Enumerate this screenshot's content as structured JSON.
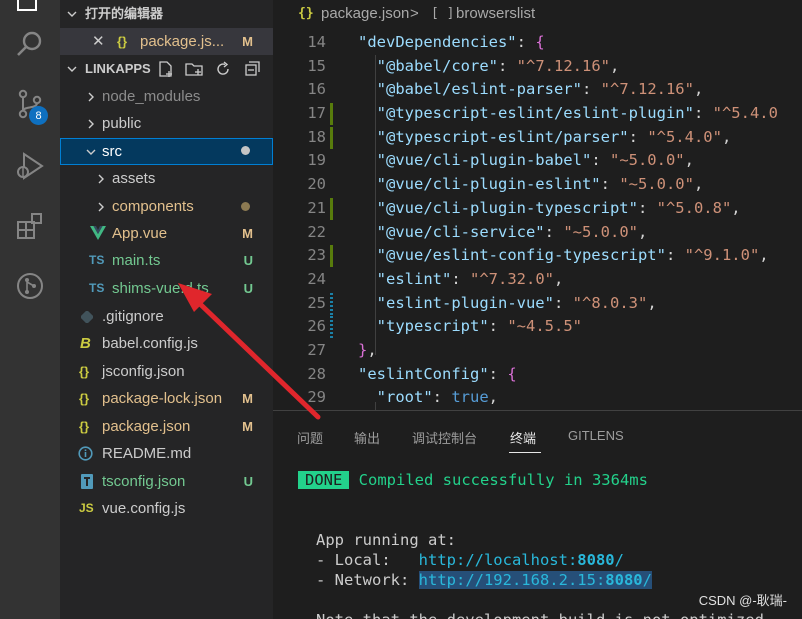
{
  "sidebar": {
    "open_editors_title": "打开的编辑器",
    "open_editor": {
      "name": "package.js...",
      "status": "M"
    },
    "project_title": "LINKAPPS",
    "items": [
      {
        "name": "node_modules",
        "status": ""
      },
      {
        "name": "public",
        "status": ""
      },
      {
        "name": "src",
        "status": ""
      },
      {
        "name": "assets",
        "status": ""
      },
      {
        "name": "components",
        "status": ""
      },
      {
        "name": "App.vue",
        "status": "M"
      },
      {
        "name": "main.ts",
        "status": "U"
      },
      {
        "name": "shims-vue.d.ts",
        "status": "U"
      },
      {
        "name": ".gitignore",
        "status": ""
      },
      {
        "name": "babel.config.js",
        "status": ""
      },
      {
        "name": "jsconfig.json",
        "status": ""
      },
      {
        "name": "package-lock.json",
        "status": "M"
      },
      {
        "name": "package.json",
        "status": "M"
      },
      {
        "name": "README.md",
        "status": ""
      },
      {
        "name": "tsconfig.json",
        "status": "U"
      },
      {
        "name": "vue.config.js",
        "status": ""
      }
    ]
  },
  "activity": {
    "source_control_badge": "8"
  },
  "breadcrumb": {
    "file": "package.json",
    "separator": ">",
    "section": "browserslist"
  },
  "editor": {
    "lines": [
      {
        "n": "14",
        "key": "\"devDependencies\"",
        "val": ""
      },
      {
        "n": "15",
        "key": "\"@babel/core\"",
        "val": "\"^7.12.16\""
      },
      {
        "n": "16",
        "key": "\"@babel/eslint-parser\"",
        "val": "\"^7.12.16\""
      },
      {
        "n": "17",
        "key": "\"@typescript-eslint/eslint-plugin\"",
        "val": "\"^5.4.0"
      },
      {
        "n": "18",
        "key": "\"@typescript-eslint/parser\"",
        "val": "\"^5.4.0\""
      },
      {
        "n": "19",
        "key": "\"@vue/cli-plugin-babel\"",
        "val": "\"~5.0.0\""
      },
      {
        "n": "20",
        "key": "\"@vue/cli-plugin-eslint\"",
        "val": "\"~5.0.0\""
      },
      {
        "n": "21",
        "key": "\"@vue/cli-plugin-typescript\"",
        "val": "\"^5.0.8\""
      },
      {
        "n": "22",
        "key": "\"@vue/cli-service\"",
        "val": "\"~5.0.0\""
      },
      {
        "n": "23",
        "key": "\"@vue/eslint-config-typescript\"",
        "val": "\"^9.1.0\""
      },
      {
        "n": "24",
        "key": "\"eslint\"",
        "val": "\"^7.32.0\""
      },
      {
        "n": "25",
        "key": "\"eslint-plugin-vue\"",
        "val": "\"^8.0.3\""
      },
      {
        "n": "26",
        "key": "\"typescript\"",
        "val": "\"~4.5.5\""
      },
      {
        "n": "27",
        "key": "",
        "val": ""
      },
      {
        "n": "28",
        "key": "\"eslintConfig\"",
        "val": ""
      },
      {
        "n": "29",
        "key": "\"root\"",
        "val": "true"
      }
    ]
  },
  "panel": {
    "tabs": [
      "问题",
      "输出",
      "调试控制台",
      "终端",
      "GITLENS"
    ],
    "active_tab": "终端"
  },
  "terminal": {
    "done_label": "DONE",
    "compiled_msg": "Compiled successfully in 3364ms",
    "app_running": "App running at:",
    "local_label": "- Local:   ",
    "local_url_prefix": "http://localhost:",
    "local_port": "8080",
    "local_url_suffix": "/",
    "network_label": "- Network: ",
    "network_url_prefix": "http://192.168.2.15:",
    "network_port": "8080",
    "network_url_suffix": "/",
    "note": "Note that the development build is not optimized."
  },
  "watermark": "CSDN @-耿瑞-",
  "colors": {
    "accent": "#0e70c0",
    "modified": "#e2c08d",
    "untracked": "#73c991",
    "arrow": "#e0262c",
    "selected_row": "#04395e"
  }
}
